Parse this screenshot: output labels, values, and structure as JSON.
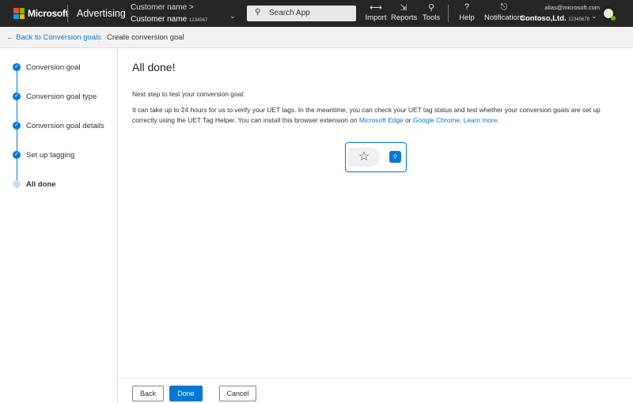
{
  "header": {
    "brand": "Microsoft",
    "product": "Advertising",
    "customer_top": "Customer name",
    "customer_name": "Customer name",
    "customer_id": "1234567",
    "search_placeholder": "Search App",
    "nav": [
      {
        "label": "Import",
        "icon": "import-icon"
      },
      {
        "label": "Reports",
        "icon": "reports-icon"
      },
      {
        "label": "Tools",
        "icon": "tools-icon"
      },
      {
        "label": "Help",
        "icon": "help-icon"
      },
      {
        "label": "Notifications",
        "icon": "bell-icon"
      }
    ],
    "email": "alias@microsoft.com",
    "account": "Contoso,Ltd.",
    "account_id": "12345678"
  },
  "subheader": {
    "back": "Back to Conversion goals",
    "title": "Create conversion goal"
  },
  "steps": [
    {
      "label": "Conversion goal",
      "done": true
    },
    {
      "label": "Conversion goal type",
      "done": true
    },
    {
      "label": "Conversion goal details",
      "done": true
    },
    {
      "label": "Set up tagging",
      "done": true
    },
    {
      "label": "All done",
      "done": false,
      "current": true
    }
  ],
  "main": {
    "title": "All done!",
    "intro": "Next step to test your conversion goal:",
    "body": "It can take up to 24 hours for us to verify your UET tags. In the meantime, you can check your UET tag status and test whether your conversion goals are set up correctly using the UET Tag Helper. You can install this browser extension on ",
    "link_edge": "Microsoft Edge",
    "or": " or ",
    "link_chrome": "Google Chrome",
    "period": ". ",
    "link_learn": "Learn more."
  },
  "footer": {
    "back": "Back",
    "done": "Done",
    "cancel": "Cancel"
  },
  "colors": {
    "accent": "#0078d4",
    "header_bg": "#262626"
  }
}
